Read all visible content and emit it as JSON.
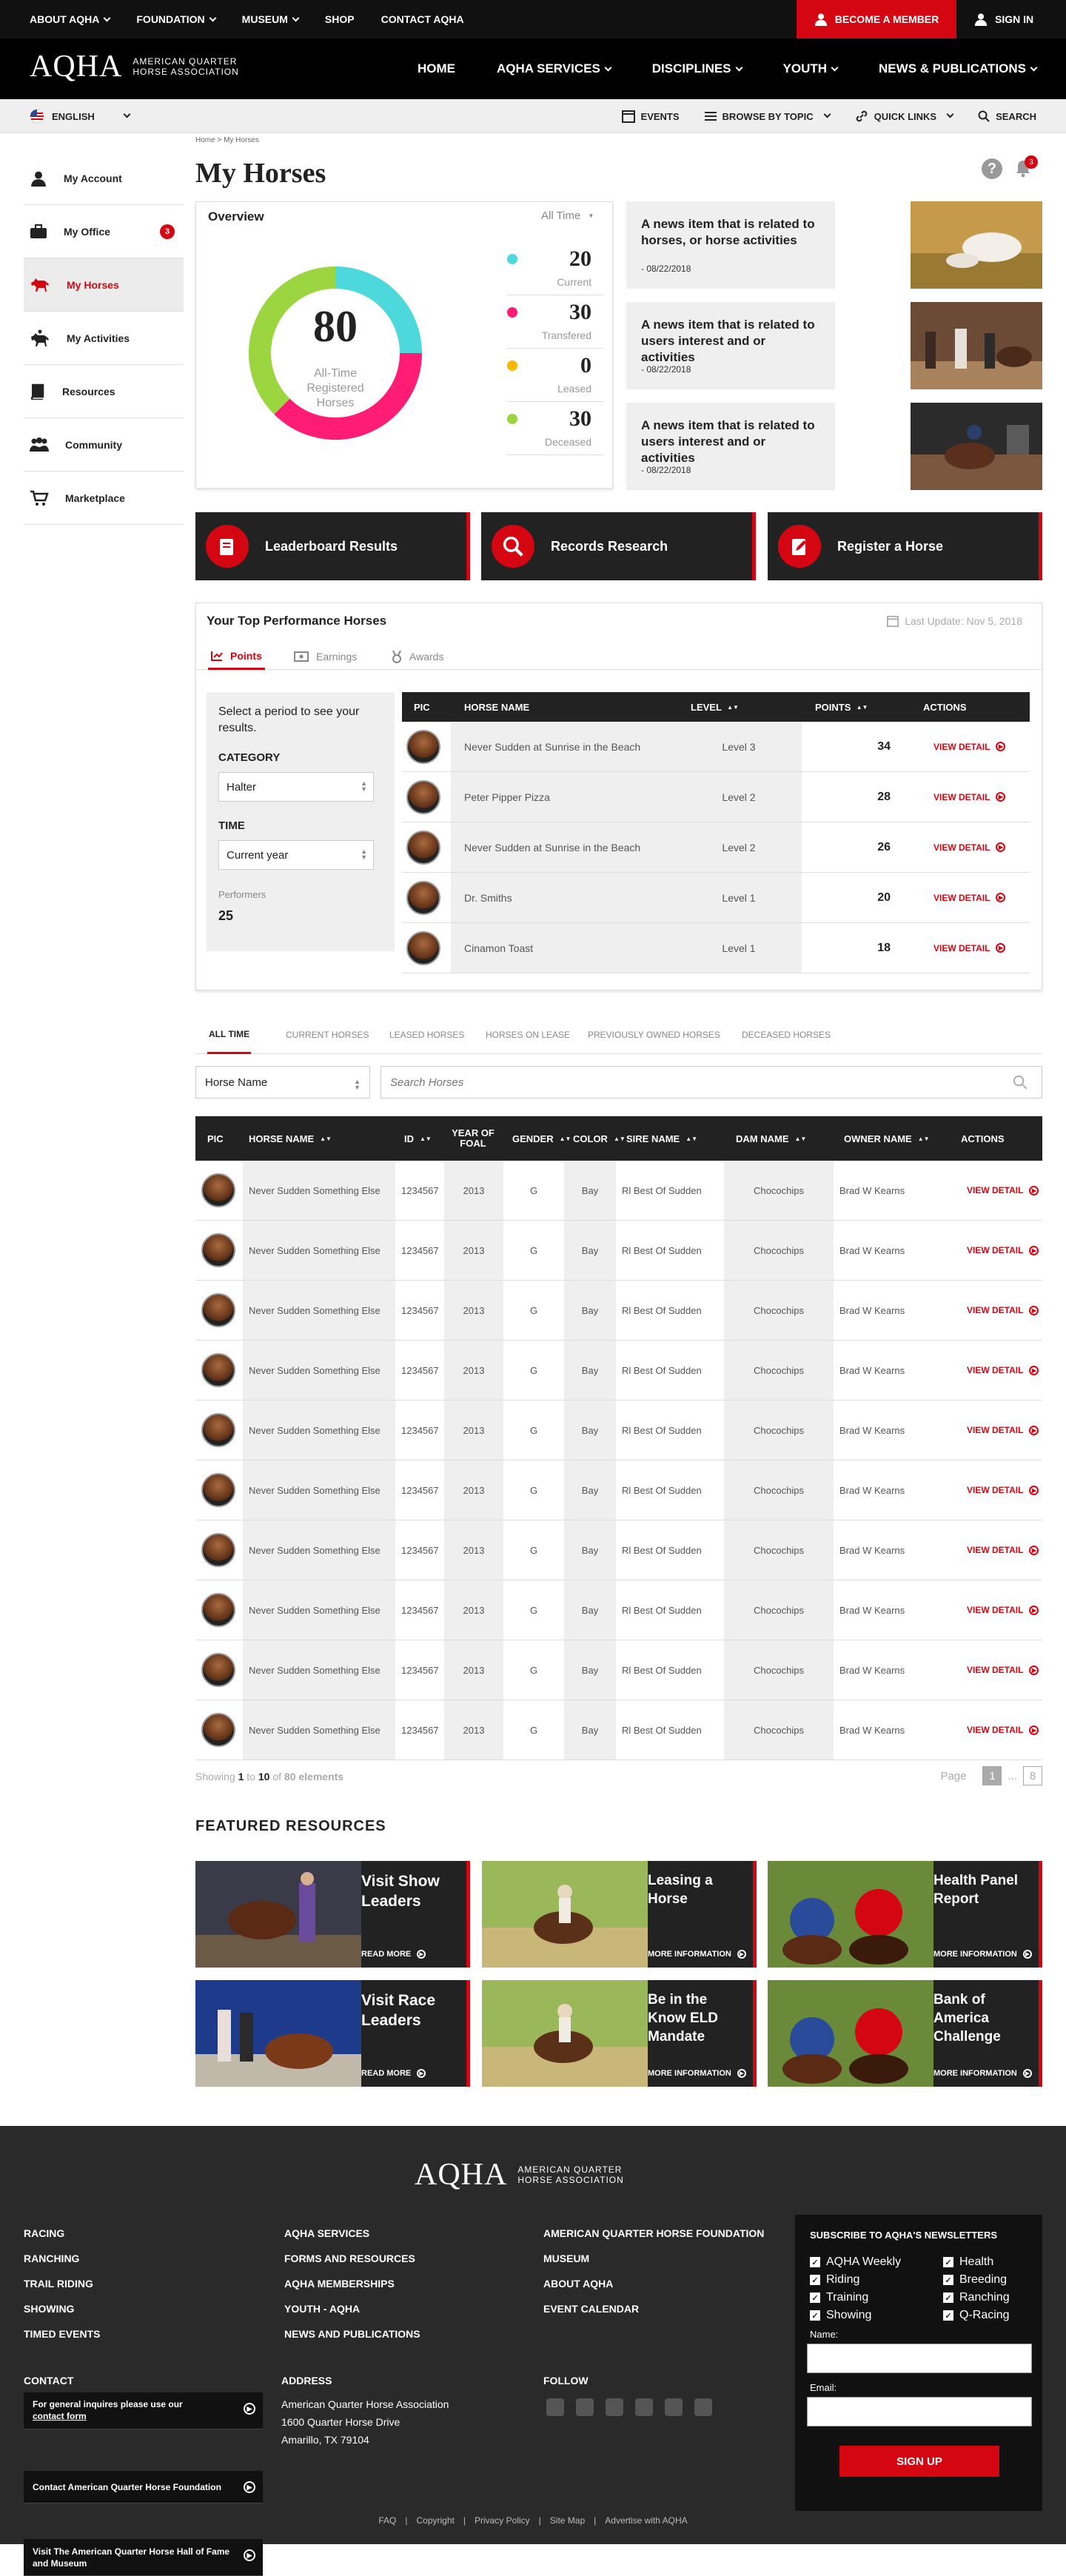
{
  "topbar": {
    "items": [
      "ABOUT AQHA",
      "FOUNDATION",
      "MUSEUM",
      "SHOP",
      "CONTACT AQHA"
    ],
    "become": "BECOME A MEMBER",
    "signin": "SIGN IN"
  },
  "brand": {
    "logo": "AQHA",
    "line1": "AMERICAN QUARTER",
    "line2": "HORSE ASSOCIATION"
  },
  "nav": {
    "items": [
      "HOME",
      "AQHA SERVICES",
      "DISCIPLINES",
      "YOUTH",
      "NEWS & PUBLICATIONS"
    ]
  },
  "subnav": {
    "language": "ENGLISH",
    "events": "EVENTS",
    "browse": "BROWSE BY TOPIC",
    "quick": "QUICK LINKS",
    "search": "SEARCH"
  },
  "breadcrumb": "Home > My Horses",
  "page_title": "My Horses",
  "notif_count": "3",
  "sidebar": {
    "items": [
      "My Account",
      "My Office",
      "My Horses",
      "My Activities",
      "Resources",
      "Community",
      "Marketplace"
    ],
    "office_badge": "3"
  },
  "overview": {
    "title": "Overview",
    "period": "All Time",
    "total": "80",
    "total_label": "All-Time Registered Horses",
    "stats": [
      {
        "value": "20",
        "label": "Current",
        "color": "#4dd9dc"
      },
      {
        "value": "30",
        "label": "Transfered",
        "color": "#ff1c74"
      },
      {
        "value": "0",
        "label": "Leased",
        "color": "#f8b800"
      },
      {
        "value": "30",
        "label": "Deceased",
        "color": "#9bd53f"
      }
    ]
  },
  "news": [
    {
      "title": "A news item that is related to horses, or horse activities",
      "date": "- 08/22/2018"
    },
    {
      "title": "A news item that is related to users interest and or activities",
      "date": "- 08/22/2018"
    },
    {
      "title": "A news item that is related to users interest and or activities",
      "date": "- 08/22/2018"
    }
  ],
  "actions": [
    "Leaderboard Results",
    "Records Research",
    "Register a Horse"
  ],
  "performance": {
    "title": "Your Top Performance Horses",
    "last_update": "Last Update: Nov 5, 2018",
    "tabs": [
      "Points",
      "Earnings",
      "Awards"
    ],
    "filter": {
      "intro": "Select a period to see your results.",
      "category_label": "CATEGORY",
      "category": "Halter",
      "time_label": "TIME",
      "time": "Current year",
      "performers_label": "Performers",
      "performers": "25"
    },
    "columns": [
      "PIC",
      "HORSE NAME",
      "LEVEL",
      "POINTS",
      "ACTIONS"
    ],
    "rows": [
      {
        "name": "Never Sudden at Sunrise in the Beach",
        "level": "Level 3",
        "points": "34"
      },
      {
        "name": "Peter Pipper Pizza",
        "level": "Level 2",
        "points": "28"
      },
      {
        "name": "Never Sudden at Sunrise in the Beach",
        "level": "Level 2",
        "points": "26"
      },
      {
        "name": "Dr. Smiths",
        "level": "Level 1",
        "points": "20"
      },
      {
        "name": "Cinamon Toast",
        "level": "Level 1",
        "points": "18"
      }
    ],
    "view": "VIEW DETAIL"
  },
  "horses_tabs": [
    "ALL TIME",
    "CURRENT HORSES",
    "LEASED HORSES",
    "HORSES ON LEASE",
    "PREVIOUSLY OWNED HORSES",
    "DECEASED HORSES"
  ],
  "horse_filter": {
    "select": "Horse Name",
    "placeholder": "Search Horses"
  },
  "horses_table": {
    "columns": [
      "PIC",
      "HORSE NAME",
      "ID",
      "YEAR OF FOAL",
      "GENDER",
      "COLOR",
      "SIRE NAME",
      "DAM NAME",
      "OWNER NAME",
      "ACTIONS"
    ],
    "row": {
      "name": "Never Sudden Something Else",
      "id": "1234567",
      "year": "2013",
      "gender": "G",
      "color": "Bay",
      "sire": "Rl Best Of Sudden",
      "dam": "Chocochips",
      "owner": "Brad W Kearns",
      "action": "VIEW DETAIL"
    }
  },
  "pagination": {
    "pre": "Showing",
    "from": "1",
    "to_word": "to",
    "to": "10",
    "of_word": "of",
    "total": "80 elements",
    "page_label": "Page",
    "current": "1",
    "dots": "...",
    "last": "8"
  },
  "featured": {
    "title": "FEATURED RESOURCES",
    "items": [
      {
        "title": "Visit Show Leaders",
        "link": "READ MORE"
      },
      {
        "title": "Leasing a Horse",
        "link": "MORE INFORMATION"
      },
      {
        "title": "Health Panel Report",
        "link": "MORE INFORMATION"
      },
      {
        "title": "Visit Race Leaders",
        "link": "READ MORE"
      },
      {
        "title": "Be in the Know ELD Mandate",
        "link": "MORE INFORMATION"
      },
      {
        "title": "Bank of America Challenge",
        "link": "MORE INFORMATION"
      }
    ]
  },
  "footer": {
    "col1": [
      "RACING",
      "RANCHING",
      "TRAIL RIDING",
      "SHOWING",
      "TIMED EVENTS"
    ],
    "col2": [
      "AQHA SERVICES",
      "FORMS AND RESOURCES",
      "AQHA MEMBERSHIPS",
      "YOUTH - AQHA",
      "NEWS AND PUBLICATIONS"
    ],
    "col3": [
      "AMERICAN QUARTER HORSE FOUNDATION",
      "MUSEUM",
      "ABOUT AQHA",
      "EVENT CALENDAR"
    ],
    "contact_title": "CONTACT",
    "contact_intro": "For general inquires please use our",
    "contact_link": "contact form",
    "contact_buttons": [
      "Contact American Quarter Horse Foundation",
      "Visit The American Quarter Horse Hall of Fame and Museum"
    ],
    "address_title": "ADDRESS",
    "address": [
      "American Quarter Horse Association",
      "1600 Quarter Horse Drive",
      "Amarillo, TX 79104"
    ],
    "follow_title": "FOLLOW",
    "newsletter_title": "SUBSCRIBE TO AQHA'S NEWSLETTERS",
    "newsletters": [
      "AQHA Weekly",
      "Health",
      "Riding",
      "Breeding",
      "Training",
      "Ranching",
      "Showing",
      "Q-Racing"
    ],
    "name_label": "Name:",
    "email_label": "Email:",
    "signup": "SIGN UP",
    "bottom_links": [
      "FAQ",
      "Copyright",
      "Privacy Policy",
      "Site Map",
      "Advertise with AQHA"
    ]
  }
}
